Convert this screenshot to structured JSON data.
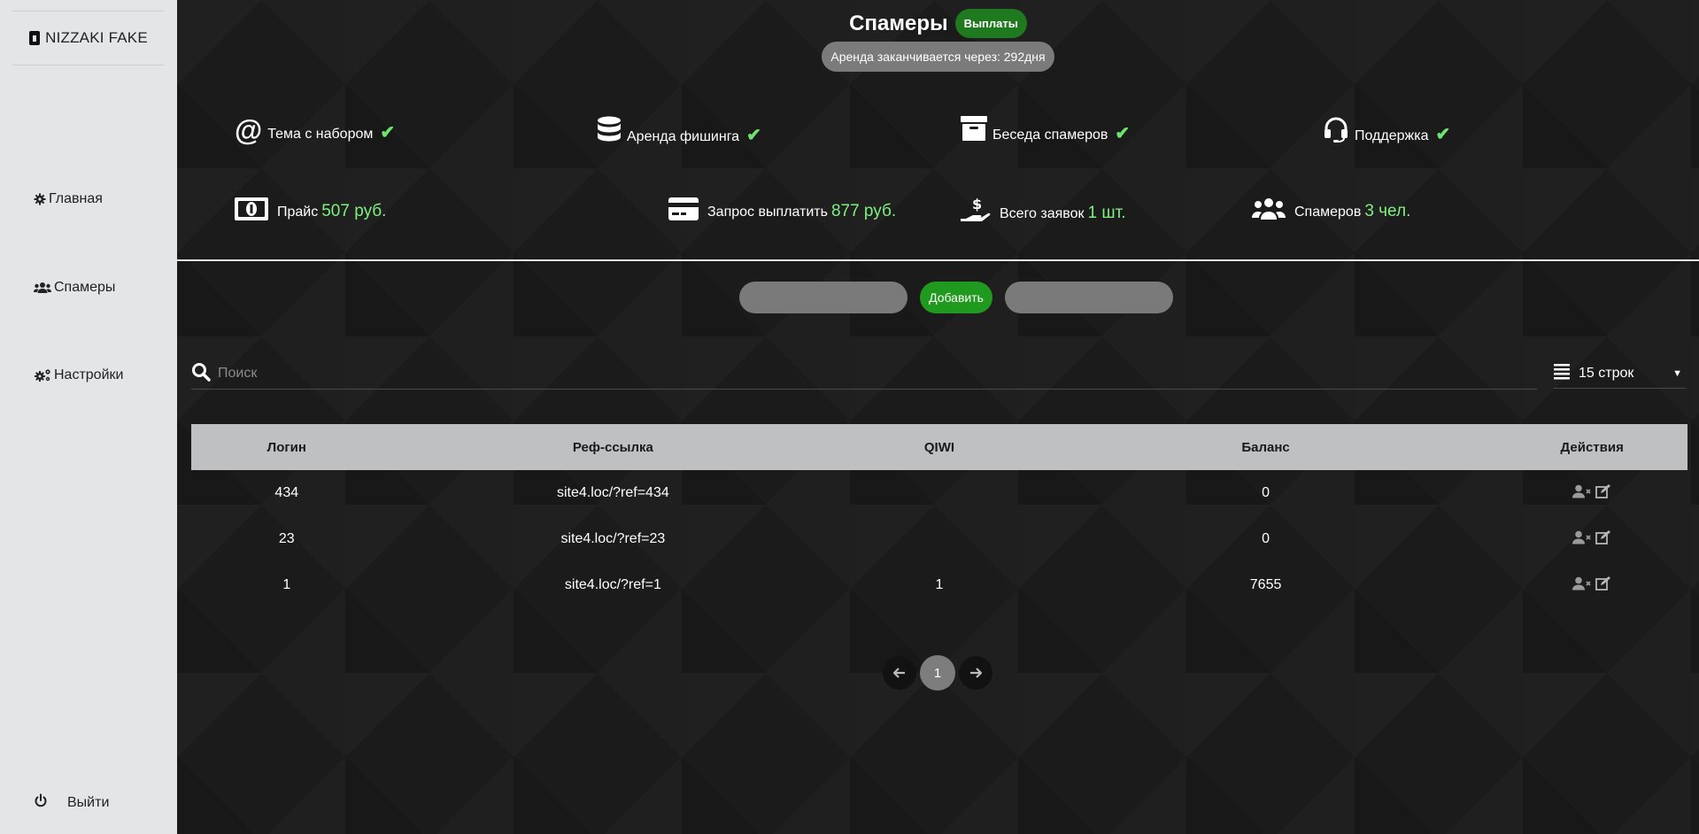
{
  "sidebar": {
    "brand": "NIZZAKI FAKE",
    "items": [
      {
        "label": "Главная",
        "icon": "gear-icon"
      },
      {
        "label": "Спамеры",
        "icon": "users-icon"
      },
      {
        "label": "Настройки",
        "icon": "cogs-icon"
      }
    ],
    "logout_label": "Выйти"
  },
  "header": {
    "title": "Спамеры",
    "payouts_label": "Выплаты",
    "rent_text": "Аренда заканчивается через: 292дня"
  },
  "features": [
    {
      "label": "Тема с набором",
      "icon": "at-icon"
    },
    {
      "label": "Аренда фишинга",
      "icon": "database-icon"
    },
    {
      "label": "Беседа спамеров",
      "icon": "archive-icon"
    },
    {
      "label": "Поддержка",
      "icon": "headset-icon"
    }
  ],
  "stats": [
    {
      "label": "Прайс",
      "value": "507 руб.",
      "icon": "money-bill-icon"
    },
    {
      "label": "Запрос выплатить",
      "value": "877 руб.",
      "icon": "credit-card-icon"
    },
    {
      "label": "Всего заявок",
      "value": "1 шт.",
      "icon": "hand-dollar-icon"
    },
    {
      "label": "Спамеров",
      "value": "3 чел.",
      "icon": "users-icon"
    }
  ],
  "toolbar": {
    "add_label": "Добавить"
  },
  "search": {
    "placeholder": "Поиск"
  },
  "rows_select": {
    "value": "15 строк"
  },
  "table": {
    "headers": [
      "Логин",
      "Реф-ссылка",
      "QIWI",
      "Баланс",
      "Действия"
    ],
    "rows": [
      {
        "login": "434",
        "ref": "site4.loc/?ref=434",
        "qiwi": "",
        "balance": "0"
      },
      {
        "login": "23",
        "ref": "site4.loc/?ref=23",
        "qiwi": "",
        "balance": "0"
      },
      {
        "login": "1",
        "ref": "site4.loc/?ref=1",
        "qiwi": "1",
        "balance": "7655"
      }
    ]
  },
  "pagination": {
    "current": "1"
  },
  "colors": {
    "accent_green": "#1f9a1f",
    "value_green": "#7ef07e",
    "sidebar_bg": "#e4e5e7"
  }
}
